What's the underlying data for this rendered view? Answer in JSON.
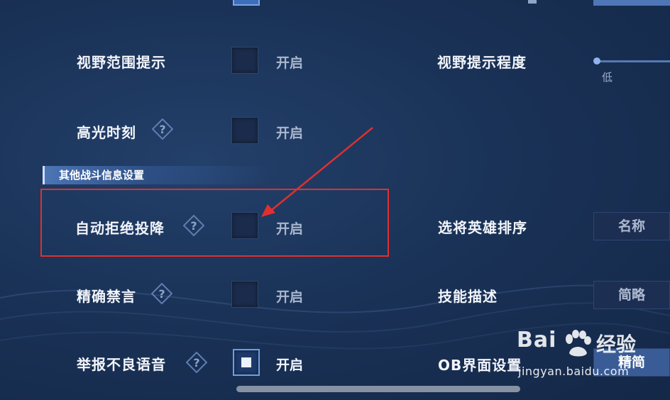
{
  "settings_left": [
    {
      "label": "视野范围提示",
      "option": "开启",
      "checked": false,
      "help": false
    },
    {
      "label": "高光时刻",
      "option": "开启",
      "checked": false,
      "help": true
    },
    {
      "label": "自动拒绝投降",
      "option": "开启",
      "checked": false,
      "help": true
    },
    {
      "label": "精确禁言",
      "option": "开启",
      "checked": false,
      "help": true
    },
    {
      "label": "举报不良语音",
      "option": "开启",
      "checked": true,
      "help": true
    }
  ],
  "settings_right": [
    {
      "label": "视野提示程度",
      "slider_low": "低"
    },
    {
      "label": "选将英雄排序",
      "value": "名称"
    },
    {
      "label": "技能描述",
      "value": "简略"
    },
    {
      "label": "OB界面设置",
      "value": "精简"
    }
  ],
  "section_header": "其他战斗信息设置",
  "watermark": {
    "brand_left": "Bai",
    "brand_right": "经验",
    "url": "jingyan.baidu.com"
  },
  "colors": {
    "accent": "#6f9ee0",
    "highlight": "#e0302e",
    "background": "#1a3257"
  },
  "icons": [
    "help-diamond-icon",
    "red-arrow-annotation",
    "baidu-paw-icon"
  ]
}
